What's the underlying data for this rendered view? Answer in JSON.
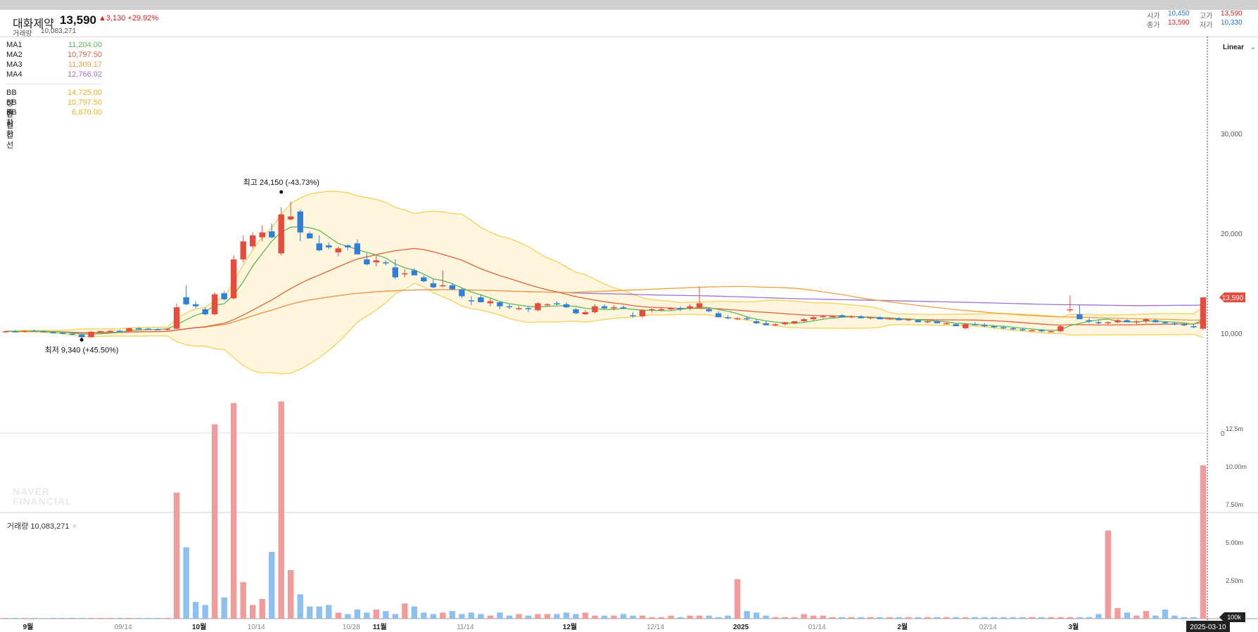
{
  "header": {
    "stock_name": "대화제약",
    "price": "13,590",
    "change": "▲3,130 +29.92%",
    "volume_label": "거래량",
    "volume_value": "10,083,271",
    "open_label": "시가",
    "open_value": "10,450",
    "high_label": "고가",
    "high_value": "13,590",
    "close_label": "종가",
    "close_value": "13,590",
    "low_label": "저가",
    "low_value": "10,330"
  },
  "legend": {
    "ma": [
      {
        "name": "MA1",
        "value": "11,204.00",
        "color": "#5cb85c"
      },
      {
        "name": "MA2",
        "value": "10,797.50",
        "color": "#e06040"
      },
      {
        "name": "MA3",
        "value": "11,309.17",
        "color": "#f0a040"
      },
      {
        "name": "MA4",
        "value": "12,766.92",
        "color": "#a070d0"
      }
    ],
    "bb": [
      {
        "name": "BB 상한선",
        "value": "14,725.00",
        "color": "#f0b020"
      },
      {
        "name": "BB 중심선",
        "value": "10,797.50",
        "color": "#f0b020"
      },
      {
        "name": "BB 하한선",
        "value": "6,870.00",
        "color": "#f0b020"
      }
    ]
  },
  "scale_label": "Linear",
  "watermark": [
    "NAVER",
    "FINANCIAL"
  ],
  "volume_panel_label": "거래량 10,083,271",
  "volume_panel_close": "×",
  "price_tag": "13,590",
  "volume_tag": "100k",
  "date_tag": "2025-03-10",
  "annotations": {
    "high": "최고 24,150 (-43.73%)",
    "low": "최저 9,340 (+45.50%)"
  },
  "colors": {
    "up": "#e84a3c",
    "down": "#2f7fd8",
    "up_vol": "#f29b9b",
    "down_vol": "#8cc0ee",
    "band_fill": "#fdf6dc",
    "band_line": "#f5d66a"
  },
  "chart_data": {
    "type": "candlestick",
    "title": "",
    "price_axis": {
      "ticks": [
        0,
        10000,
        20000,
        30000
      ],
      "tick_labels": [
        "0",
        "10,000",
        "20,000",
        "30,000"
      ]
    },
    "volume_axis": {
      "ticks": [
        2.5,
        5,
        7.5,
        10,
        12.5
      ],
      "tick_labels": [
        "2.50m",
        "5.00m",
        "7.50m",
        "10.00m",
        "12.5m"
      ],
      "unit": "m"
    },
    "x_labels": [
      {
        "label": "9월",
        "bold": true,
        "index": 0
      },
      {
        "label": "09/14",
        "bold": false,
        "index": 10
      },
      {
        "label": "10월",
        "bold": true,
        "index": 18
      },
      {
        "label": "10/14",
        "bold": false,
        "index": 24
      },
      {
        "label": "10/28",
        "bold": false,
        "index": 34
      },
      {
        "label": "11월",
        "bold": true,
        "index": 37
      },
      {
        "label": "11/14",
        "bold": false,
        "index": 46
      },
      {
        "label": "12월",
        "bold": true,
        "index": 57
      },
      {
        "label": "12/14",
        "bold": false,
        "index": 66
      },
      {
        "label": "2025",
        "bold": true,
        "index": 75
      },
      {
        "label": "01/14",
        "bold": false,
        "index": 83
      },
      {
        "label": "2월",
        "bold": true,
        "index": 92
      },
      {
        "label": "02/14",
        "bold": false,
        "index": 101
      },
      {
        "label": "3월",
        "bold": true,
        "index": 110
      }
    ],
    "candles": [
      [
        10150,
        10250,
        10050,
        10200
      ],
      [
        10200,
        10300,
        10100,
        10150
      ],
      [
        10150,
        10250,
        10050,
        10250
      ],
      [
        10250,
        10350,
        10150,
        10200
      ],
      [
        10200,
        10250,
        10100,
        10100
      ],
      [
        10100,
        10200,
        10000,
        10050
      ],
      [
        10050,
        10150,
        9900,
        9950
      ],
      [
        9950,
        10050,
        9800,
        9850
      ],
      [
        9850,
        9950,
        9340,
        9600
      ],
      [
        9600,
        10200,
        9550,
        10150
      ],
      [
        10150,
        10250,
        10050,
        10200
      ],
      [
        10200,
        10300,
        10100,
        10250
      ],
      [
        10250,
        10350,
        10150,
        10200
      ],
      [
        10200,
        10550,
        10150,
        10500
      ],
      [
        10500,
        10600,
        10400,
        10450
      ],
      [
        10450,
        10550,
        10350,
        10400
      ],
      [
        10400,
        10500,
        10300,
        10350
      ],
      [
        10350,
        10500,
        10250,
        10450
      ],
      [
        10450,
        13000,
        10400,
        12600
      ],
      [
        13600,
        14800,
        12800,
        12900
      ],
      [
        12900,
        13200,
        12500,
        12700
      ],
      [
        12400,
        12600,
        11800,
        11900
      ],
      [
        11900,
        14100,
        11800,
        13900
      ],
      [
        14000,
        14200,
        13300,
        13400
      ],
      [
        13500,
        17800,
        13400,
        17400
      ],
      [
        17400,
        19800,
        17100,
        19200
      ],
      [
        18700,
        20100,
        18500,
        19800
      ],
      [
        19600,
        20800,
        19200,
        20100
      ],
      [
        20200,
        21000,
        19500,
        19600
      ],
      [
        18000,
        22600,
        17800,
        21900
      ],
      [
        21400,
        23200,
        21300,
        21700
      ],
      [
        22200,
        22400,
        19200,
        20100
      ],
      [
        20000,
        20200,
        19500,
        19500
      ],
      [
        19000,
        19800,
        18200,
        18300
      ],
      [
        18800,
        19100,
        18400,
        18600
      ],
      [
        18100,
        18700,
        17700,
        18500
      ],
      [
        18800,
        18900,
        18300,
        18600
      ],
      [
        19000,
        19400,
        18100,
        17900
      ],
      [
        17400,
        18000,
        16800,
        16900
      ],
      [
        17100,
        17900,
        16700,
        17300
      ],
      [
        17100,
        17300,
        16800,
        17000
      ],
      [
        16600,
        17400,
        15400,
        15600
      ],
      [
        15900,
        16400,
        15600,
        16000
      ],
      [
        16300,
        16500,
        15800,
        15800
      ],
      [
        15600,
        15800,
        15100,
        15200
      ],
      [
        15000,
        15400,
        14500,
        14600
      ],
      [
        14700,
        16300,
        14600,
        14800
      ],
      [
        14800,
        15000,
        14300,
        14400
      ],
      [
        14400,
        14500,
        13500,
        13700
      ],
      [
        13300,
        13700,
        12800,
        13200
      ],
      [
        13600,
        13900,
        13100,
        13100
      ],
      [
        13000,
        13500,
        12700,
        13200
      ],
      [
        13100,
        13200,
        12400,
        12700
      ],
      [
        12700,
        12900,
        12400,
        12600
      ],
      [
        12500,
        12700,
        12300,
        12500
      ],
      [
        12500,
        12700,
        12100,
        12400
      ],
      [
        12300,
        13100,
        12200,
        13000
      ],
      [
        12900,
        13000,
        12700,
        12900
      ],
      [
        13000,
        13200,
        12800,
        12900
      ],
      [
        12900,
        13100,
        12500,
        12600
      ],
      [
        12400,
        12500,
        11900,
        12000
      ],
      [
        11900,
        12300,
        11800,
        12100
      ],
      [
        12100,
        12900,
        12000,
        12700
      ],
      [
        12700,
        12900,
        12400,
        12500
      ],
      [
        12500,
        12800,
        12300,
        12600
      ],
      [
        12600,
        12800,
        12400,
        12500
      ],
      [
        11800,
        12100,
        11600,
        11700
      ],
      [
        11700,
        12400,
        11500,
        12300
      ],
      [
        12300,
        12500,
        12100,
        12400
      ],
      [
        12400,
        12600,
        12200,
        12400
      ],
      [
        12400,
        12600,
        12300,
        12500
      ],
      [
        12500,
        12700,
        12200,
        12400
      ],
      [
        12500,
        12900,
        12300,
        12700
      ],
      [
        12600,
        14700,
        12500,
        13000
      ],
      [
        12400,
        12500,
        12100,
        12200
      ],
      [
        12000,
        12200,
        11600,
        11600
      ],
      [
        11600,
        11800,
        11400,
        11500
      ],
      [
        11400,
        11600,
        11300,
        11500
      ],
      [
        11500,
        11700,
        11300,
        11400
      ],
      [
        11200,
        11400,
        10900,
        11000
      ],
      [
        11000,
        11200,
        10800,
        10800
      ],
      [
        10800,
        11000,
        10700,
        10900
      ],
      [
        10900,
        11100,
        10800,
        11100
      ],
      [
        11000,
        11200,
        10900,
        11200
      ],
      [
        11200,
        11500,
        11100,
        11400
      ],
      [
        11400,
        11700,
        11300,
        11600
      ],
      [
        11600,
        11800,
        11500,
        11700
      ],
      [
        11700,
        11800,
        11600,
        11700
      ],
      [
        11800,
        11900,
        11600,
        11600
      ],
      [
        11600,
        11800,
        11500,
        11700
      ],
      [
        11700,
        11800,
        11500,
        11500
      ],
      [
        11500,
        11600,
        11400,
        11600
      ],
      [
        11600,
        11700,
        11400,
        11400
      ],
      [
        11400,
        11500,
        11300,
        11500
      ],
      [
        11500,
        11600,
        11300,
        11300
      ],
      [
        11300,
        11400,
        11200,
        11400
      ],
      [
        11300,
        11400,
        11100,
        11100
      ],
      [
        11100,
        11300,
        11000,
        11200
      ],
      [
        11200,
        11300,
        11000,
        11000
      ],
      [
        11000,
        11100,
        10900,
        11000
      ],
      [
        10900,
        11000,
        10700,
        10700
      ],
      [
        10500,
        11000,
        10400,
        10900
      ],
      [
        10900,
        11100,
        10800,
        10800
      ],
      [
        10800,
        11000,
        10600,
        10700
      ],
      [
        10700,
        10800,
        10500,
        10600
      ],
      [
        10600,
        10700,
        10400,
        10500
      ],
      [
        10500,
        10600,
        10300,
        10400
      ],
      [
        10400,
        10500,
        10200,
        10300
      ],
      [
        10300,
        10400,
        10200,
        10300
      ],
      [
        10300,
        10400,
        10100,
        10200
      ],
      [
        10200,
        10300,
        10100,
        10200
      ],
      [
        10200,
        10800,
        10100,
        10700
      ],
      [
        12300,
        13800,
        12100,
        12400
      ],
      [
        11900,
        12800,
        11600,
        11400
      ],
      [
        11300,
        11500,
        11000,
        11200
      ],
      [
        11100,
        11300,
        10900,
        11000
      ],
      [
        11000,
        11200,
        10900,
        11100
      ],
      [
        11100,
        11400,
        11000,
        11300
      ],
      [
        11300,
        11400,
        11100,
        11100
      ],
      [
        11100,
        11300,
        10900,
        11200
      ],
      [
        11200,
        11500,
        11000,
        11400
      ],
      [
        11300,
        11400,
        11100,
        11100
      ],
      [
        11100,
        11200,
        10900,
        11000
      ],
      [
        11000,
        11100,
        10800,
        10900
      ],
      [
        10900,
        11000,
        10700,
        10800
      ],
      [
        10700,
        10900,
        10500,
        10600
      ],
      [
        10450,
        13590,
        10330,
        13590
      ]
    ],
    "volume_millions": [
      0.05,
      0.05,
      0.05,
      0.05,
      0.04,
      0.05,
      0.05,
      0.05,
      0.05,
      0.05,
      0.05,
      0.05,
      0.05,
      0.05,
      0.05,
      0.05,
      0.05,
      0.05,
      8.3,
      4.7,
      1.1,
      0.9,
      12.8,
      1.4,
      14.2,
      2.4,
      0.9,
      1.3,
      4.4,
      14.3,
      3.2,
      1.6,
      0.8,
      0.8,
      0.9,
      0.4,
      0.3,
      0.6,
      0.4,
      0.6,
      0.5,
      0.3,
      1.0,
      0.8,
      0.4,
      0.3,
      0.4,
      0.5,
      0.3,
      0.4,
      0.3,
      0.2,
      0.4,
      0.2,
      0.3,
      0.2,
      0.3,
      0.3,
      0.3,
      0.4,
      0.3,
      0.4,
      0.2,
      0.2,
      0.2,
      0.3,
      0.2,
      0.2,
      0.1,
      0.1,
      0.2,
      0.1,
      0.2,
      0.2,
      0.2,
      0.1,
      0.2,
      2.6,
      0.5,
      0.4,
      0.2,
      0.1,
      0.1,
      0.1,
      0.3,
      0.2,
      0.2,
      0.1,
      0.1,
      0.1,
      0.1,
      0.1,
      0.1,
      0.1,
      0.1,
      0.1,
      0.1,
      0.1,
      0.1,
      0.1,
      0.1,
      0.1,
      0.1,
      0.1,
      0.1,
      0.1,
      0.1,
      0.1,
      0.1,
      0.1,
      0.1,
      0.1,
      0.1,
      0.1,
      0.1,
      0.3,
      5.8,
      0.7,
      0.4,
      0.2,
      0.5,
      0.2,
      0.6,
      0.2,
      0.1,
      0.1,
      10.1
    ]
  }
}
